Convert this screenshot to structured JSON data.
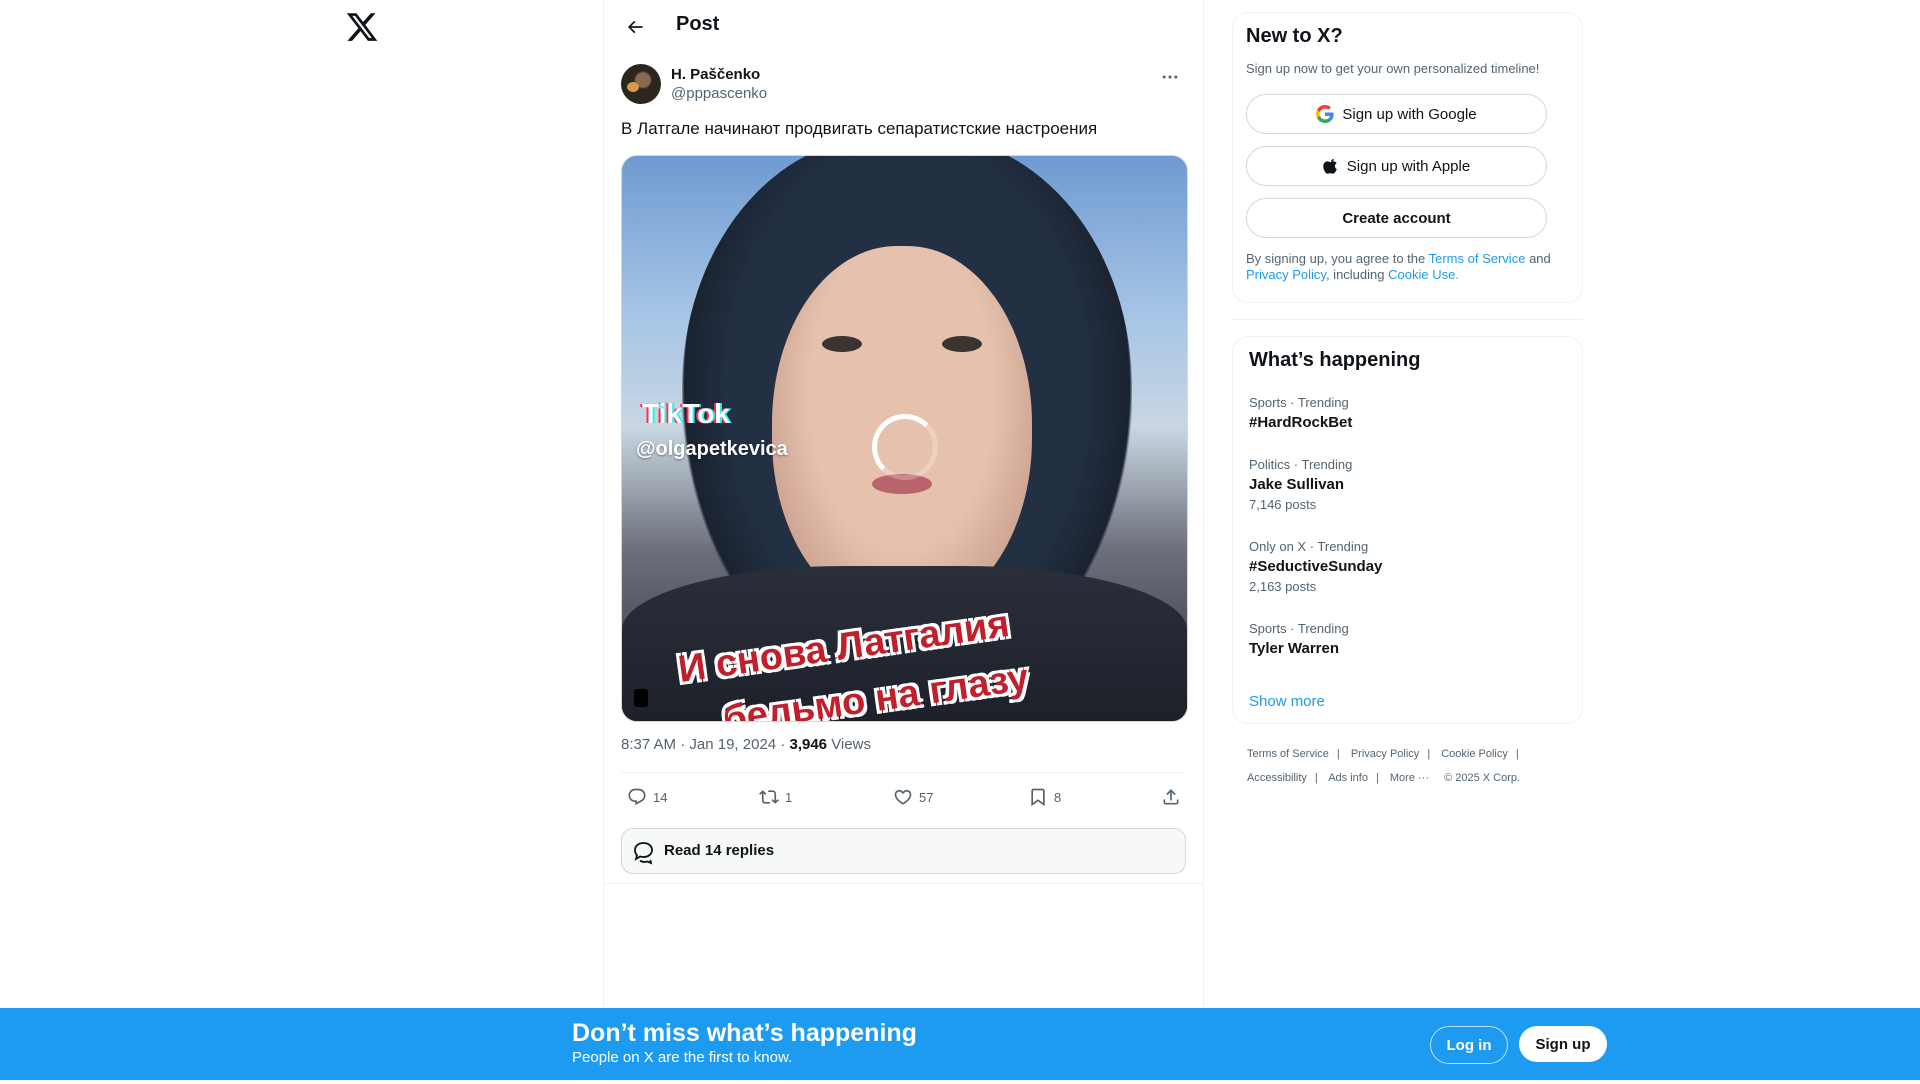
{
  "app": {
    "logo": "x-logo"
  },
  "post": {
    "header_title": "Post",
    "author_name": "H. Paščenko",
    "author_handle": "@pppascenko",
    "text": "В Латгале начинают продвигать сепаратистские настроения",
    "media": {
      "overlay_brand": "TikTok",
      "overlay_handle": "@olgapetkevica",
      "caption_line_1": "И снова Латгалия",
      "caption_line_2": "бельмо на глазу",
      "state": "loading"
    },
    "time": "8:37 AM",
    "date": "Jan 19, 2024",
    "views_count": "3,946",
    "views_label": "Views",
    "actions": {
      "replies": "14",
      "reposts": "1",
      "likes": "57",
      "bookmarks": "8"
    },
    "read_replies_label": "Read 14 replies"
  },
  "signup": {
    "title": "New to X?",
    "subtitle": "Sign up now to get your own personalized timeline!",
    "google_label": "Sign up with Google",
    "apple_label": "Sign up with Apple",
    "create_label": "Create account",
    "legal_prefix": "By signing up, you agree to the",
    "terms_link": "Terms of Service",
    "and": "and",
    "privacy_link": "Privacy Policy",
    "including": ", including",
    "cookie_link": "Cookie Use."
  },
  "trending": {
    "title": "What’s happening",
    "items": [
      {
        "category": "Sports · Trending",
        "name": "#HardRockBet",
        "posts": ""
      },
      {
        "category": "Politics · Trending",
        "name": "Jake Sullivan",
        "posts": "7,146 posts"
      },
      {
        "category": "Only on X · Trending",
        "name": "#SeductiveSunday",
        "posts": "2,163 posts"
      },
      {
        "category": "Sports · Trending",
        "name": "Tyler Warren",
        "posts": ""
      }
    ],
    "show_more": "Show more"
  },
  "footer": {
    "links": [
      "Terms of Service",
      "Privacy Policy",
      "Cookie Policy",
      "Accessibility",
      "Ads info",
      "More ···"
    ],
    "copyright": "© 2025 X Corp."
  },
  "bottom_bar": {
    "title": "Don’t miss what’s happening",
    "subtitle": "People on X are the first to know.",
    "login_label": "Log in",
    "signup_label": "Sign up"
  },
  "colors": {
    "accent": "#1d9bf0",
    "text": "#0f1419",
    "muted": "#536471",
    "border": "#eff3f4"
  }
}
